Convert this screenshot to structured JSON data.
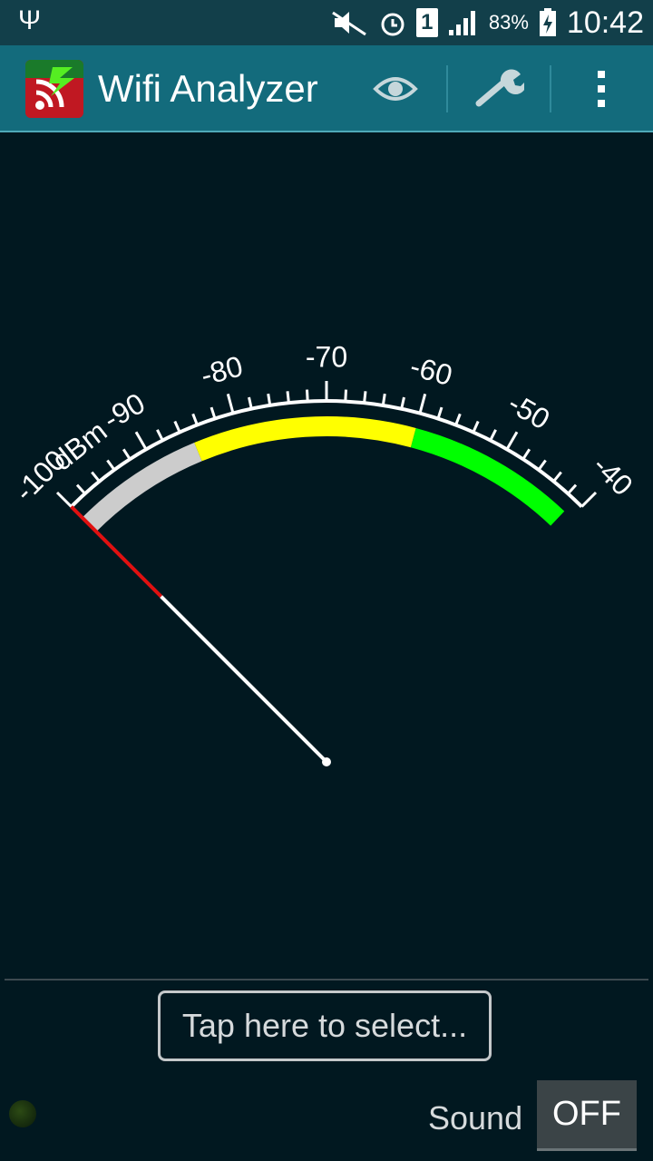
{
  "status_bar": {
    "time": "10:42",
    "battery": "83%",
    "sim_slot": "1",
    "icons": [
      "usb-icon",
      "mute-icon",
      "alarm-icon",
      "sim-icon",
      "signal-icon",
      "battery-charging-icon"
    ]
  },
  "app_bar": {
    "title": "Wifi Analyzer",
    "actions": [
      "eye-icon",
      "wrench-icon",
      "overflow-menu-icon"
    ]
  },
  "gauge": {
    "unit": "dBm",
    "min": -100,
    "max": -40,
    "major_ticks": [
      "-100",
      "-90",
      "-80",
      "-70",
      "-60",
      "-50",
      "-40"
    ],
    "needle_value": -100,
    "zones": [
      {
        "from": -100,
        "to": -85,
        "color": "#cccccc"
      },
      {
        "from": -85,
        "to": -60,
        "color": "#ffff00"
      },
      {
        "from": -60,
        "to": -41,
        "color": "#00ff00"
      }
    ]
  },
  "footer": {
    "select_text": "Tap here to select...",
    "sound_label": "Sound",
    "sound_toggle": "OFF"
  }
}
